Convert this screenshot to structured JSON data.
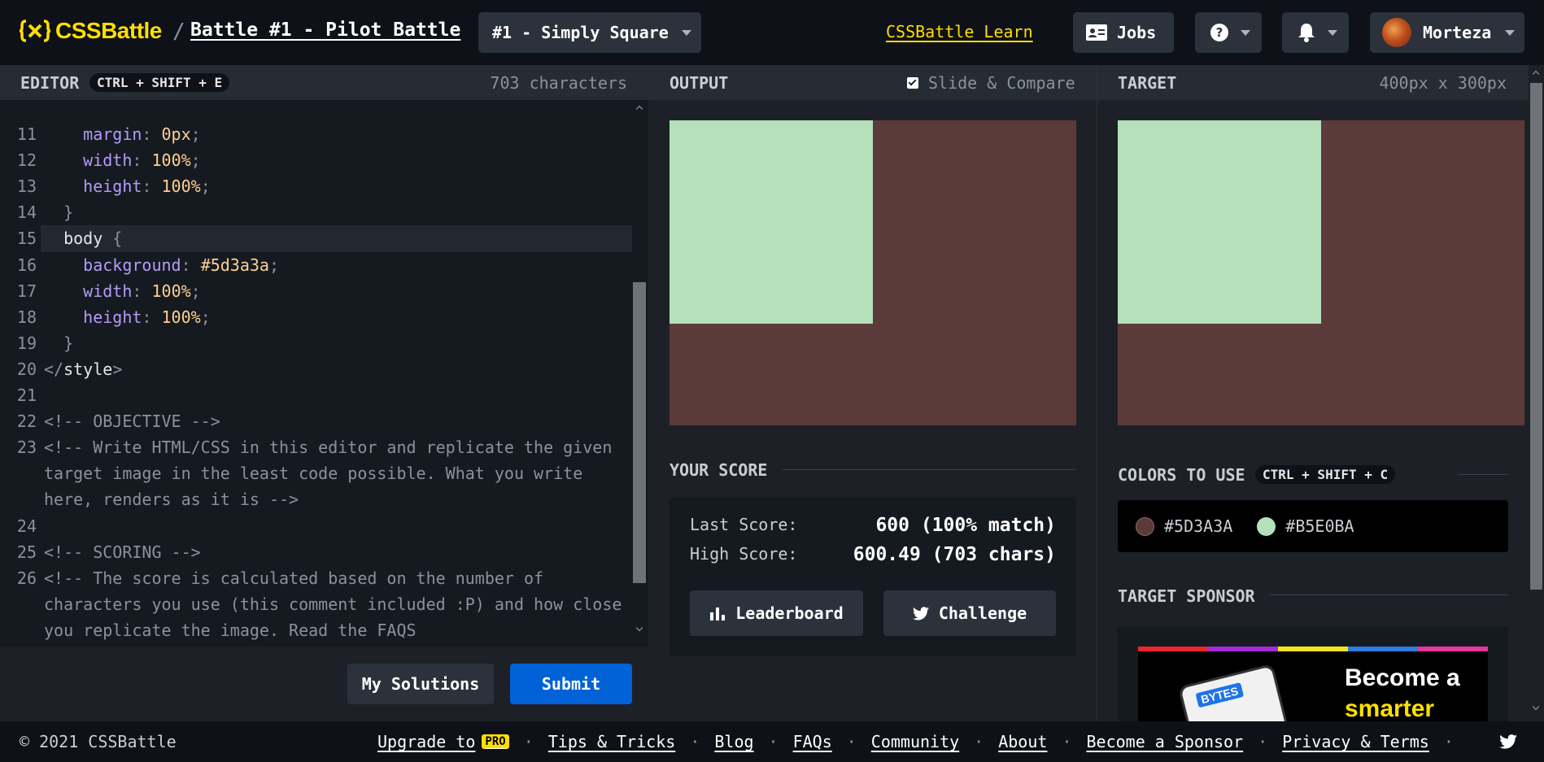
{
  "header": {
    "logo_text": "CSSBattle",
    "separator": "/",
    "battle_title": "Battle #1 - Pilot Battle",
    "level_dropdown": "#1 - Simply Square",
    "learn_link": "CSSBattle Learn",
    "jobs_label": "Jobs",
    "user_name": "Morteza"
  },
  "editor": {
    "title": "EDITOR",
    "shortcut": "CTRL + SHIFT + E",
    "char_count": "703 characters",
    "lines": [
      {
        "n": "11",
        "parts": [
          [
            "",
            "    "
          ],
          [
            "prop",
            "margin"
          ],
          [
            "punc",
            ": "
          ],
          [
            "val",
            "0px"
          ],
          [
            "punc",
            ";"
          ]
        ]
      },
      {
        "n": "12",
        "parts": [
          [
            "",
            "    "
          ],
          [
            "prop",
            "width"
          ],
          [
            "punc",
            ": "
          ],
          [
            "val",
            "100%"
          ],
          [
            "punc",
            ";"
          ]
        ]
      },
      {
        "n": "13",
        "parts": [
          [
            "",
            "    "
          ],
          [
            "prop",
            "height"
          ],
          [
            "punc",
            ": "
          ],
          [
            "val",
            "100%"
          ],
          [
            "punc",
            ";"
          ]
        ]
      },
      {
        "n": "14",
        "parts": [
          [
            "punc",
            "  }"
          ]
        ]
      },
      {
        "n": "15",
        "parts": [
          [
            "",
            "  "
          ],
          [
            "tag",
            "body"
          ],
          [
            "punc",
            " {"
          ]
        ]
      },
      {
        "n": "16",
        "parts": [
          [
            "",
            "    "
          ],
          [
            "prop",
            "background"
          ],
          [
            "punc",
            ": "
          ],
          [
            "val",
            "#5d3a3a"
          ],
          [
            "punc",
            ";"
          ]
        ]
      },
      {
        "n": "17",
        "parts": [
          [
            "",
            "    "
          ],
          [
            "prop",
            "width"
          ],
          [
            "punc",
            ": "
          ],
          [
            "val",
            "100%"
          ],
          [
            "punc",
            ";"
          ]
        ]
      },
      {
        "n": "18",
        "parts": [
          [
            "",
            "    "
          ],
          [
            "prop",
            "height"
          ],
          [
            "punc",
            ": "
          ],
          [
            "val",
            "100%"
          ],
          [
            "punc",
            ";"
          ]
        ]
      },
      {
        "n": "19",
        "parts": [
          [
            "punc",
            "  }"
          ]
        ]
      },
      {
        "n": "20",
        "parts": [
          [
            "punc",
            "</"
          ],
          [
            "tag",
            "style"
          ],
          [
            "punc",
            ">"
          ]
        ]
      },
      {
        "n": "21",
        "parts": []
      },
      {
        "n": "22",
        "parts": [
          [
            "cmt",
            "<!-- OBJECTIVE -->"
          ]
        ]
      },
      {
        "n": "23",
        "parts": [
          [
            "cmt",
            "<!-- Write HTML/CSS in this editor and replicate the given"
          ]
        ]
      },
      {
        "n": "",
        "parts": [
          [
            "cmt",
            "target image in the least code possible. What you write"
          ]
        ]
      },
      {
        "n": "",
        "parts": [
          [
            "cmt",
            "here, renders as it is -->"
          ]
        ]
      },
      {
        "n": "24",
        "parts": []
      },
      {
        "n": "25",
        "parts": [
          [
            "cmt",
            "<!-- SCORING -->"
          ]
        ]
      },
      {
        "n": "26",
        "parts": [
          [
            "cmt",
            "<!-- The score is calculated based on the number of"
          ]
        ]
      },
      {
        "n": "",
        "parts": [
          [
            "cmt",
            "characters you use (this comment included :P) and how close"
          ]
        ]
      },
      {
        "n": "",
        "parts": [
          [
            "cmt",
            "you replicate the image. Read the FAQS"
          ]
        ]
      }
    ],
    "my_solutions": "My Solutions",
    "submit": "Submit"
  },
  "output": {
    "title": "OUTPUT",
    "slide_compare": "Slide & Compare",
    "slide_compare_checked": true
  },
  "target": {
    "title": "TARGET",
    "dimensions": "400px x 300px"
  },
  "score": {
    "title": "YOUR SCORE",
    "last_label": "Last Score:",
    "last_value": "600 (100% match)",
    "high_label": "High Score:",
    "high_value": "600.49 (703 chars)",
    "leaderboard": "Leaderboard",
    "challenge": "Challenge"
  },
  "colors": {
    "title": "COLORS TO USE",
    "shortcut": "CTRL + SHIFT + C",
    "list": [
      {
        "hex": "#5D3A3A",
        "color": "#5d3a3a"
      },
      {
        "hex": "#B5E0BA",
        "color": "#b5e0ba"
      }
    ]
  },
  "sponsor": {
    "title": "TARGET SPONSOR",
    "headline_1": "Become a",
    "headline_2": "smarter",
    "phone_brand": "BYTES"
  },
  "footer": {
    "copyright": "© 2021 CSSBattle",
    "upgrade": "Upgrade to",
    "pro_badge": "PRO",
    "links": [
      "Tips & Tricks",
      "Blog",
      "FAQs",
      "Community",
      "About",
      "Become a Sponsor",
      "Privacy & Terms"
    ]
  },
  "theme": {
    "accent": "#ffdf00",
    "submit_blue": "#0062d6",
    "canvas_bg": "#5d3a3a",
    "square": "#b5e0ba"
  }
}
